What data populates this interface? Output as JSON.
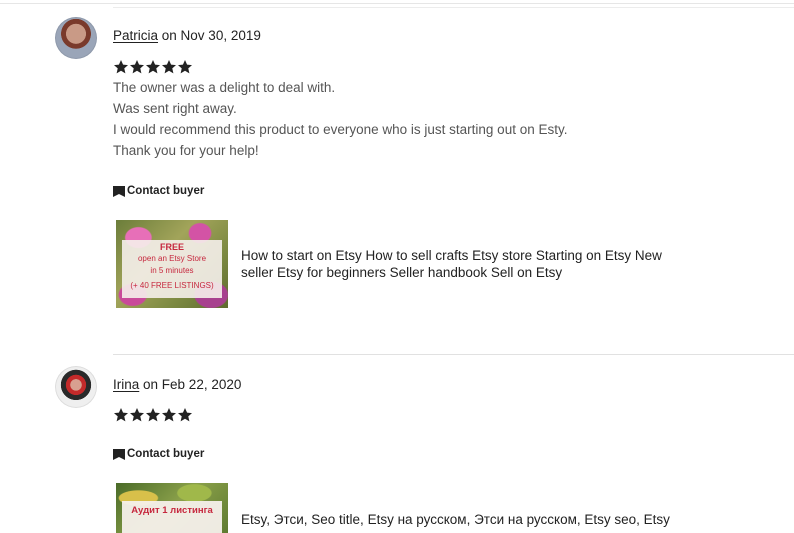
{
  "reviews": [
    {
      "reviewer": "Patricia",
      "date_prefix": " on ",
      "date": "Nov 30, 2019",
      "rating": 5,
      "text_lines": [
        "The owner was a delight to deal with.",
        "Was sent right away.",
        "I would recommend this product to everyone who is just starting out on Esty.",
        "Thank you for your help!"
      ],
      "contact_label": "Contact buyer",
      "listing": {
        "title": "How to start on Etsy How to sell crafts Etsy store Starting on Etsy New seller Etsy for beginners Seller handbook Sell on Etsy",
        "thumb_lines": [
          "FREE",
          "open an Etsy Store",
          "in 5 minutes",
          "(+ 40 FREE LISTINGS)"
        ]
      }
    },
    {
      "reviewer": "Irina",
      "date_prefix": " on ",
      "date": "Feb 22, 2020",
      "rating": 5,
      "contact_label": "Contact buyer",
      "listing": {
        "title": "Etsy, Этси, Seo title, Etsy на русском, Этси на русском, Etsy seo, Etsy",
        "thumb_lines": [
          "Аудит 1 листинга"
        ]
      }
    }
  ],
  "colors": {
    "star": "#222222",
    "text_muted": "#555555",
    "accent_red": "#c6283e"
  },
  "icons": {
    "star": "star-icon",
    "contact": "envelope-flag-icon"
  }
}
